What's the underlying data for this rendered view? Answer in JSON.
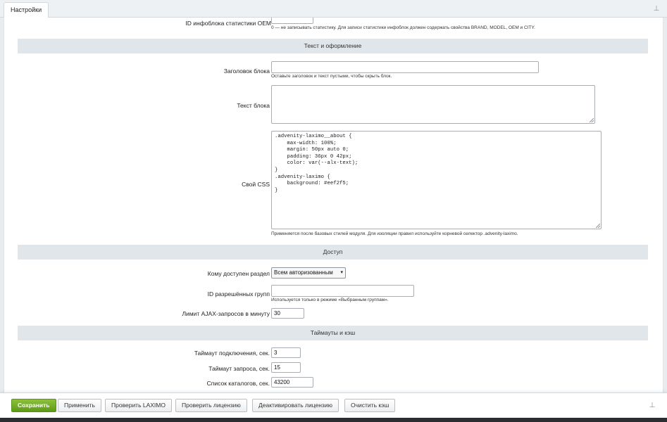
{
  "tab": {
    "label": "Настройки"
  },
  "fields": {
    "oem": {
      "label": "ID инфоблока статистики OEM",
      "value": "",
      "hint": "0 — не записывать статистику. Для записи статистики инфоблок должен содержать свойства BRAND, MODEL, OEM и CITY."
    },
    "block_title": {
      "label": "Заголовок блока",
      "value": "",
      "hint": "Оставьте заголовок и текст пустыми, чтобы скрыть блок."
    },
    "block_text": {
      "label": "Текст блока",
      "value": ""
    },
    "custom_css": {
      "label": "Свой CSS",
      "value": ".advenity-laximo__about {\n    max-width: 100%;\n    margin: 50px auto 0;\n    padding: 36px 0 42px;\n    color: var(--alx-text);\n}\n.advenity-laximo {\n    background: #eef2f5;\n}",
      "hint": "Применяется после базовых стилей модуля. Для изоляции правил используйте корневой селектор .advenity-laximo."
    },
    "access": {
      "label": "Кому доступен раздел",
      "selected": "Всем авторизованным"
    },
    "groups": {
      "label": "ID разрешённых групп",
      "value": "",
      "hint": "Используется только в режиме «Выбранным группам»."
    },
    "ajax_limit": {
      "label": "Лимит AJAX-запросов в минуту",
      "value": "30"
    },
    "conn_timeout": {
      "label": "Таймаут подключения, сек.",
      "value": "3"
    },
    "req_timeout": {
      "label": "Таймаут запроса, сек.",
      "value": "15"
    },
    "catalogs": {
      "label": "Список каталогов, сек.",
      "value": "43200"
    }
  },
  "sections": {
    "appearance": "Текст и оформление",
    "access": "Доступ",
    "timeouts": "Таймауты и кэш"
  },
  "buttons": {
    "save": "Сохранить",
    "apply": "Применить",
    "check_laximo": "Проверить LAXIMO",
    "check_license": "Проверить лицензию",
    "deactivate_license": "Деактивировать лицензию",
    "clear_cache": "Очистить кэш"
  },
  "icons": {
    "pin": "pin-icon",
    "dropdown": "chevron-down-icon"
  },
  "colors": {
    "primary_button": "#6aa520",
    "section_bg": "#e0e6ea",
    "background": "#e9ecef"
  }
}
